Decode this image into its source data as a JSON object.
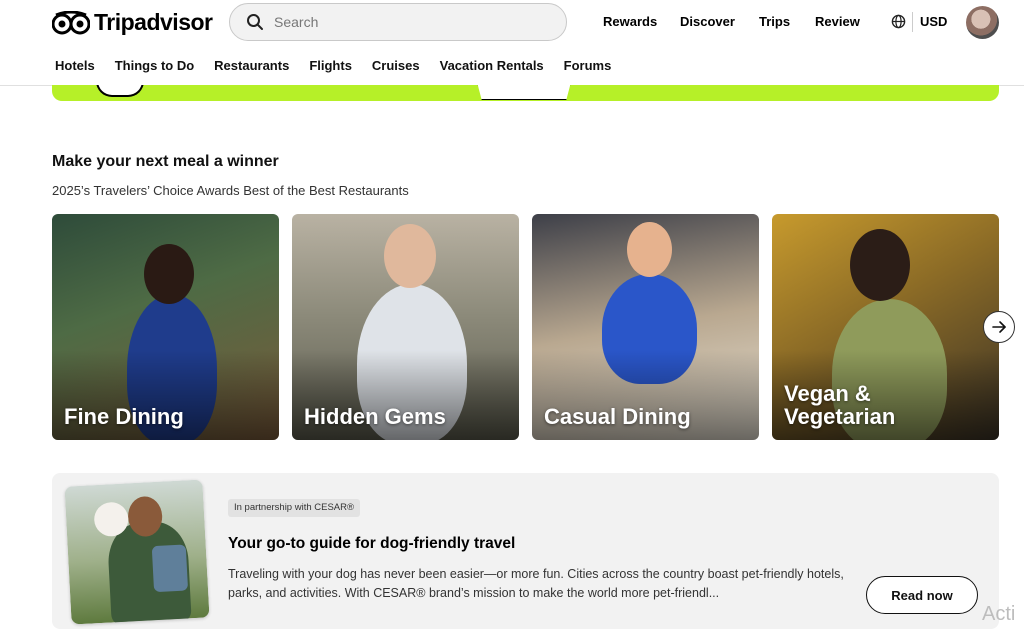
{
  "brand": {
    "name": "Tripadvisor",
    "accent": "#34e0a1",
    "banner_color": "#b6f028"
  },
  "search": {
    "placeholder": "Search"
  },
  "top_nav": {
    "rewards": "Rewards",
    "discover": "Discover",
    "trips": "Trips",
    "review": "Review",
    "currency": "USD"
  },
  "sub_nav": [
    "Hotels",
    "Things to Do",
    "Restaurants",
    "Flights",
    "Cruises",
    "Vacation Rentals",
    "Forums"
  ],
  "section": {
    "title": "Make your next meal a winner",
    "subtitle": "2025’s Travelers’ Choice Awards Best of the Best Restaurants"
  },
  "cards": [
    {
      "line1": "Fine Dining",
      "line2": ""
    },
    {
      "line1": "Hidden Gems",
      "line2": ""
    },
    {
      "line1": "Casual Dining",
      "line2": ""
    },
    {
      "line1": "Vegan &",
      "line2": "Vegetarian"
    }
  ],
  "promo": {
    "badge": "In partnership with CESAR®",
    "title": "Your go-to guide for dog-friendly travel",
    "text": "Traveling with your dog has never been easier—or more fun. Cities across the country boast pet-friendly hotels, parks, and activities. With CESAR® brand’s mission to make the world more pet-friendl...",
    "button": "Read now"
  },
  "watermark": "Acti"
}
